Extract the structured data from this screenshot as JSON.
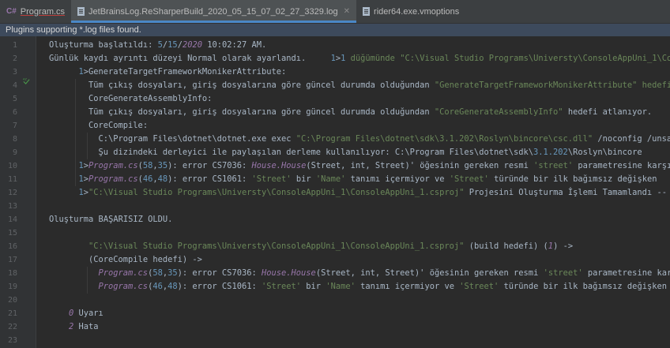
{
  "tabs": [
    {
      "badge": "C#",
      "label": "Program.cs",
      "active": false
    },
    {
      "label": "JetBrainsLog.ReSharperBuild_2020_05_15_07_02_27_3329.log",
      "active": true
    },
    {
      "label": "rider64.exe.vmoptions",
      "active": false
    }
  ],
  "banner": "Plugins supporting *.log files found.",
  "line_numbers": [
    "1",
    "2",
    "3",
    "4",
    "5",
    "6",
    "7",
    "8",
    "9",
    "10",
    "11",
    "12",
    "13",
    "14",
    "15",
    "16",
    "17",
    "18",
    "19",
    "20",
    "21",
    "22",
    "23"
  ],
  "lines": [
    {
      "indent": 0,
      "segs": [
        [
          "Oluşturma başlatıldı: ",
          "k"
        ],
        [
          "5",
          "n"
        ],
        [
          "/",
          "k"
        ],
        [
          "15",
          "n"
        ],
        [
          "/",
          "k"
        ],
        [
          "2020",
          "i"
        ],
        [
          " 10:02:27 AM.",
          "k"
        ]
      ]
    },
    {
      "indent": 0,
      "segs": [
        [
          "Günlük kaydı ayrıntı düzeyi Normal olarak ayarlandı.     ",
          "k"
        ],
        [
          "1",
          "n"
        ],
        [
          ">",
          "k"
        ],
        [
          "1",
          "n"
        ],
        [
          " düğümünde \"C:\\Visual Studio Programs\\Universty\\ConsoleAppUni_1\\ConsoleAppUni_1.csproj\"",
          "s"
        ]
      ]
    },
    {
      "indent": 3,
      "segs": [
        [
          "1",
          "n"
        ],
        [
          ">GenerateTargetFrameworkMonikerAttribute:",
          "k"
        ]
      ]
    },
    {
      "indent": 4,
      "segs": [
        [
          "Tüm çıkış dosyaları, giriş dosyalarına göre güncel durumda olduğundan ",
          "k"
        ],
        [
          "\"GenerateTargetFrameworkMonikerAttribute\" hedefi atlanıyor.",
          "s"
        ]
      ]
    },
    {
      "indent": 4,
      "segs": [
        [
          "CoreGenerateAssemblyInfo:",
          "k"
        ]
      ]
    },
    {
      "indent": 4,
      "segs": [
        [
          "Tüm çıkış dosyaları, giriş dosyalarına göre güncel durumda olduğundan ",
          "k"
        ],
        [
          "\"CoreGenerateAssemblyInfo\" ",
          "s"
        ],
        [
          "hedefi atlanıyor.",
          "k"
        ]
      ]
    },
    {
      "indent": 4,
      "segs": [
        [
          "CoreCompile:",
          "k"
        ]
      ]
    },
    {
      "indent": 5,
      "segs": [
        [
          "C:\\Program Files\\dotnet\\dotnet.exe exec ",
          "k"
        ],
        [
          "\"C:\\Program Files\\dotnet\\sdk\\3.1.202\\Roslyn\\bincore\\csc.dll\"",
          "s"
        ],
        [
          " /noconfig /unsafe-",
          "k"
        ]
      ]
    },
    {
      "indent": 5,
      "segs": [
        [
          "Şu dizindeki derleyici ile paylaşılan derleme kullanılıyor: C:\\Program Files\\dotnet\\sdk\\",
          "k"
        ],
        [
          "3.1.202",
          "n"
        ],
        [
          "\\Roslyn\\bincore",
          "k"
        ]
      ]
    },
    {
      "indent": 3,
      "segs": [
        [
          "1",
          "n"
        ],
        [
          ">",
          "k"
        ],
        [
          "Program.cs",
          "i"
        ],
        [
          "(",
          "k"
        ],
        [
          "58",
          "n"
        ],
        [
          ",",
          "k"
        ],
        [
          "35",
          "n"
        ],
        [
          "): error CS7036: ",
          "k"
        ],
        [
          "House.House",
          "i"
        ],
        [
          "(Street, int, Street)' öğesinin gereken resmi ",
          "k"
        ],
        [
          "'street'",
          "s"
        ],
        [
          " parametresine karşılık",
          "k"
        ]
      ]
    },
    {
      "indent": 3,
      "segs": [
        [
          "1",
          "n"
        ],
        [
          ">",
          "k"
        ],
        [
          "Program.cs",
          "i"
        ],
        [
          "(",
          "k"
        ],
        [
          "46",
          "n"
        ],
        [
          ",",
          "k"
        ],
        [
          "48",
          "n"
        ],
        [
          "): error CS1061: ",
          "k"
        ],
        [
          "'Street'",
          "s"
        ],
        [
          " bir ",
          "k"
        ],
        [
          "'Name'",
          "s"
        ],
        [
          " tanımı içermiyor ve ",
          "k"
        ],
        [
          "'Street'",
          "s"
        ],
        [
          " türünde bir ilk bağımsız değişken",
          "k"
        ]
      ]
    },
    {
      "indent": 3,
      "segs": [
        [
          "1",
          "n"
        ],
        [
          ">",
          "k"
        ],
        [
          "\"C:\\Visual Studio Programs\\Universty\\ConsoleAppUni_1\\ConsoleAppUni_1.csproj\"",
          "s"
        ],
        [
          " Projesini Oluşturma İşlemi Tamamlandı --",
          "k"
        ]
      ]
    },
    {
      "indent": 0,
      "segs": [
        [
          "",
          "k"
        ]
      ]
    },
    {
      "indent": 0,
      "segs": [
        [
          "Oluşturma BAŞARISIZ OLDU.",
          "k"
        ]
      ]
    },
    {
      "indent": 0,
      "segs": [
        [
          "",
          "k"
        ]
      ]
    },
    {
      "indent": 4,
      "segs": [
        [
          "\"C:\\Visual Studio Programs\\Universty\\ConsoleAppUni_1\\ConsoleAppUni_1.csproj\"",
          "s"
        ],
        [
          " (build hedefi) (",
          "k"
        ],
        [
          "1",
          "i"
        ],
        [
          ") ->",
          "k"
        ]
      ]
    },
    {
      "indent": 4,
      "segs": [
        [
          "(CoreCompile hedefi) ->",
          "k"
        ]
      ]
    },
    {
      "indent": 5,
      "segs": [
        [
          "Program.cs",
          "i"
        ],
        [
          "(",
          "k"
        ],
        [
          "58",
          "n"
        ],
        [
          ",",
          "k"
        ],
        [
          "35",
          "n"
        ],
        [
          "): error CS7036: ",
          "k"
        ],
        [
          "House.House",
          "i"
        ],
        [
          "(Street, int, Street)' öğesinin gereken resmi ",
          "k"
        ],
        [
          "'street'",
          "s"
        ],
        [
          " parametresine karşılık",
          "k"
        ]
      ]
    },
    {
      "indent": 5,
      "segs": [
        [
          "Program.cs",
          "i"
        ],
        [
          "(",
          "k"
        ],
        [
          "46",
          "n"
        ],
        [
          ",",
          "k"
        ],
        [
          "48",
          "n"
        ],
        [
          "): error CS1061: ",
          "k"
        ],
        [
          "'Street'",
          "s"
        ],
        [
          " bir ",
          "k"
        ],
        [
          "'Name'",
          "s"
        ],
        [
          " tanımı içermiyor ve ",
          "k"
        ],
        [
          "'Street'",
          "s"
        ],
        [
          " türünde bir ilk bağımsız değişken",
          "k"
        ]
      ]
    },
    {
      "indent": 0,
      "segs": [
        [
          "",
          "k"
        ]
      ]
    },
    {
      "indent": 2,
      "segs": [
        [
          "0",
          "i"
        ],
        [
          " Uyarı",
          "k"
        ]
      ]
    },
    {
      "indent": 2,
      "segs": [
        [
          "2",
          "i"
        ],
        [
          " Hata",
          "k"
        ]
      ]
    },
    {
      "indent": 0,
      "segs": [
        [
          "",
          "k"
        ]
      ]
    }
  ],
  "colors": {
    "background": "#2b2b2b",
    "gutter": "#313335",
    "banner": "#3d4a5c",
    "string": "#6a8759",
    "number": "#6897bb",
    "italic": "#9876aa",
    "text": "#a9b7c6"
  }
}
